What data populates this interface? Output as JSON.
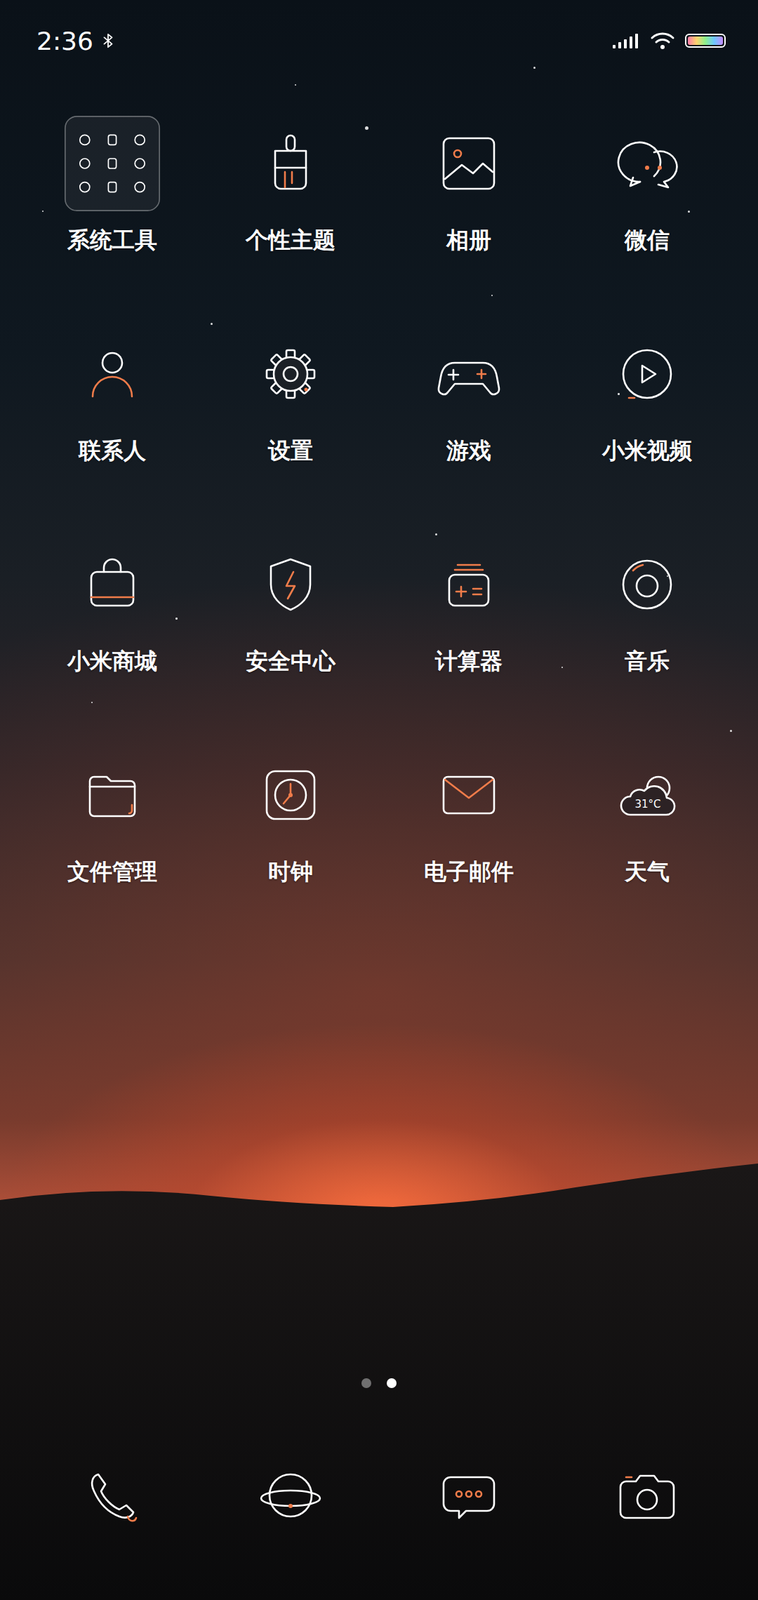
{
  "status_bar": {
    "time": "2:36",
    "bluetooth": true,
    "signal_level": 1,
    "wifi_level": 1,
    "battery_level": 1
  },
  "apps": [
    {
      "label": "系统工具"
    },
    {
      "label": "个性主题"
    },
    {
      "label": "相册"
    },
    {
      "label": "微信"
    },
    {
      "label": "联系人"
    },
    {
      "label": "设置"
    },
    {
      "label": "游戏"
    },
    {
      "label": "小米视频"
    },
    {
      "label": "小米商城"
    },
    {
      "label": "安全中心"
    },
    {
      "label": "计算器"
    },
    {
      "label": "音乐"
    },
    {
      "label": "文件管理"
    },
    {
      "label": "时钟"
    },
    {
      "label": "电子邮件"
    },
    {
      "label": "天气",
      "icon_text": "31°C"
    }
  ],
  "pages": [
    {
      "selected": false
    },
    {
      "selected": true
    }
  ]
}
